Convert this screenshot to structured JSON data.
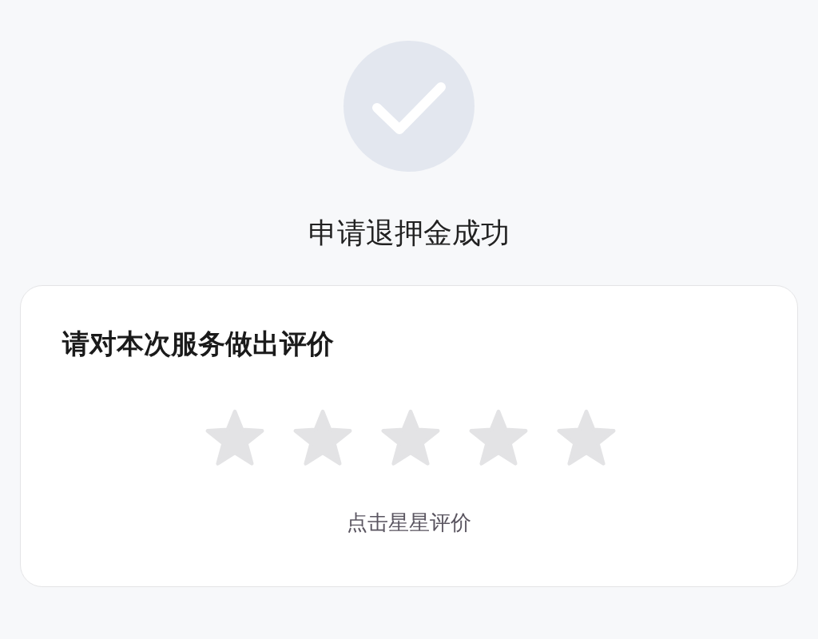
{
  "status": {
    "title": "申请退押金成功"
  },
  "rating": {
    "heading": "请对本次服务做出评价",
    "stars": 0,
    "hint": "点击星星评价"
  }
}
